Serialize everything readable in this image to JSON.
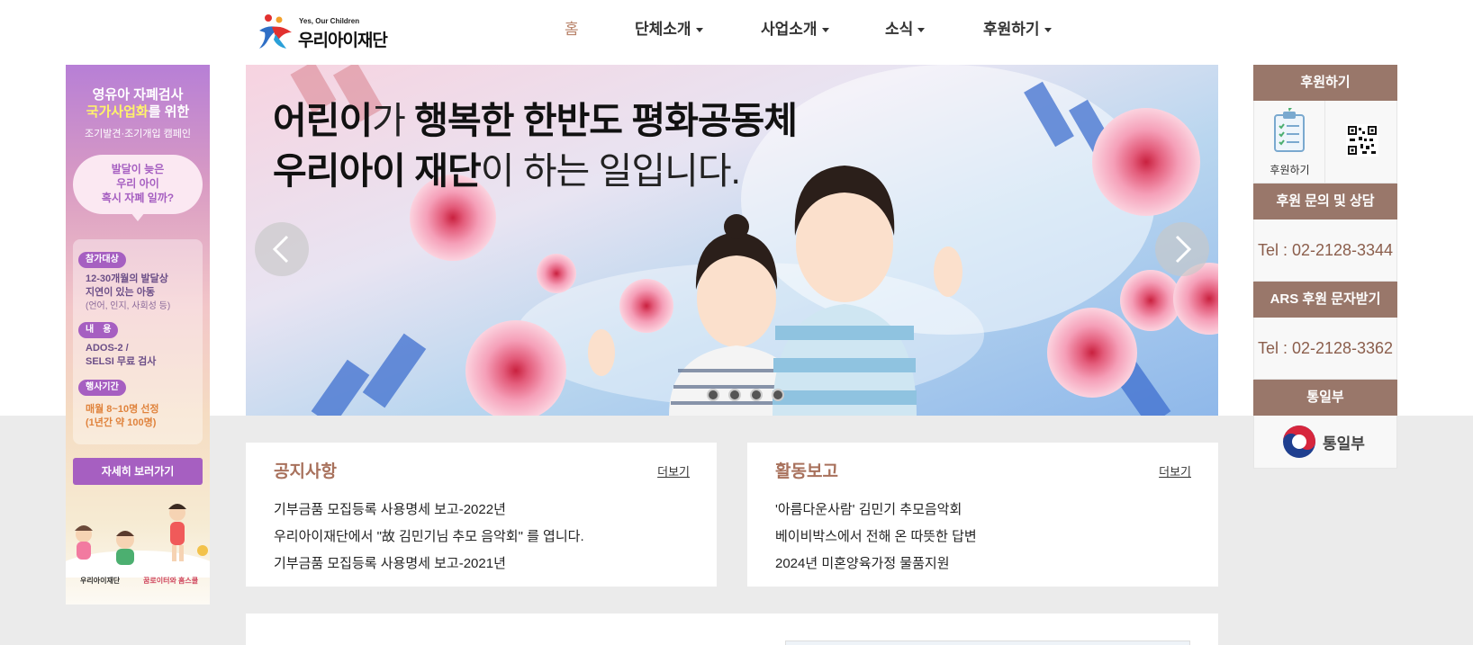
{
  "header": {
    "logo_tagline": "Yes, Our Children",
    "logo_name": "우리아이재단",
    "nav": [
      {
        "label": "홈",
        "active": true
      },
      {
        "label": "단체소개",
        "dropdown": true
      },
      {
        "label": "사업소개",
        "dropdown": true
      },
      {
        "label": "소식",
        "dropdown": true
      },
      {
        "label": "후원하기",
        "dropdown": true
      }
    ]
  },
  "left_banner": {
    "line1": "영유아 자폐검사",
    "line2_highlight": "국가사업화",
    "line2_rest": "를 위한",
    "line3": "조기발견·조기개입 캠페인",
    "bubble": [
      "발달이 늦은",
      "우리 아이",
      "혹시 자폐 일까?"
    ],
    "target_label": "참가대상",
    "target_text": [
      "12-30개월의 발달상",
      "지연이 있는 아동"
    ],
    "target_sub": "(언어, 인지, 사회성 등)",
    "content_label": "내　용",
    "content_text": [
      "ADOS-2 /",
      "SELSI 무료 검사"
    ],
    "period_label": "행사기간",
    "period_text": [
      "매월 8~10명 선정",
      "(1년간 약 100명)"
    ],
    "button": "자세히 보러가기",
    "footer_logo1": "우리아이재단",
    "footer_logo2": "꿈로이터와 홈스쿨"
  },
  "hero": {
    "line1_bold1": "어린이",
    "line1_light": "가 ",
    "line1_bold2": "행복한 한반도 평화공동체",
    "line2_bold": "우리아이 재단",
    "line2_light": "이 하는 일입니다.",
    "slide_count": 4
  },
  "sidebar": {
    "donate_title": "후원하기",
    "donate_label": "후원하기",
    "inquiry_title": "후원 문의 및 상담",
    "inquiry_tel": "Tel : 02-2128-3344",
    "ars_title": "ARS 후원 문자받기",
    "ars_tel": "Tel : 02-2128-3362",
    "ministry_title": "통일부",
    "ministry_logo": "통일부"
  },
  "notice": {
    "title": "공지사항",
    "more": "더보기",
    "items": [
      "기부금품 모집등록 사용명세 보고-2022년",
      "우리아이재단에서 \"故 김민기님 추모 음악회\" 를 엽니다.",
      "기부금품 모집등록 사용명세 보고-2021년"
    ]
  },
  "activity": {
    "title": "활동보고",
    "more": "더보기",
    "items": [
      "'아름다운사람' 김민기 추모음악회",
      "베이비박스에서 전해 온 따뜻한 답변",
      "2024년 미혼양육가정 물품지원"
    ]
  },
  "colors": {
    "accent_brown": "#99776a",
    "title_brown": "#a8715c",
    "nav_active": "#b8836a",
    "banner_purple": "#a65fc1"
  }
}
